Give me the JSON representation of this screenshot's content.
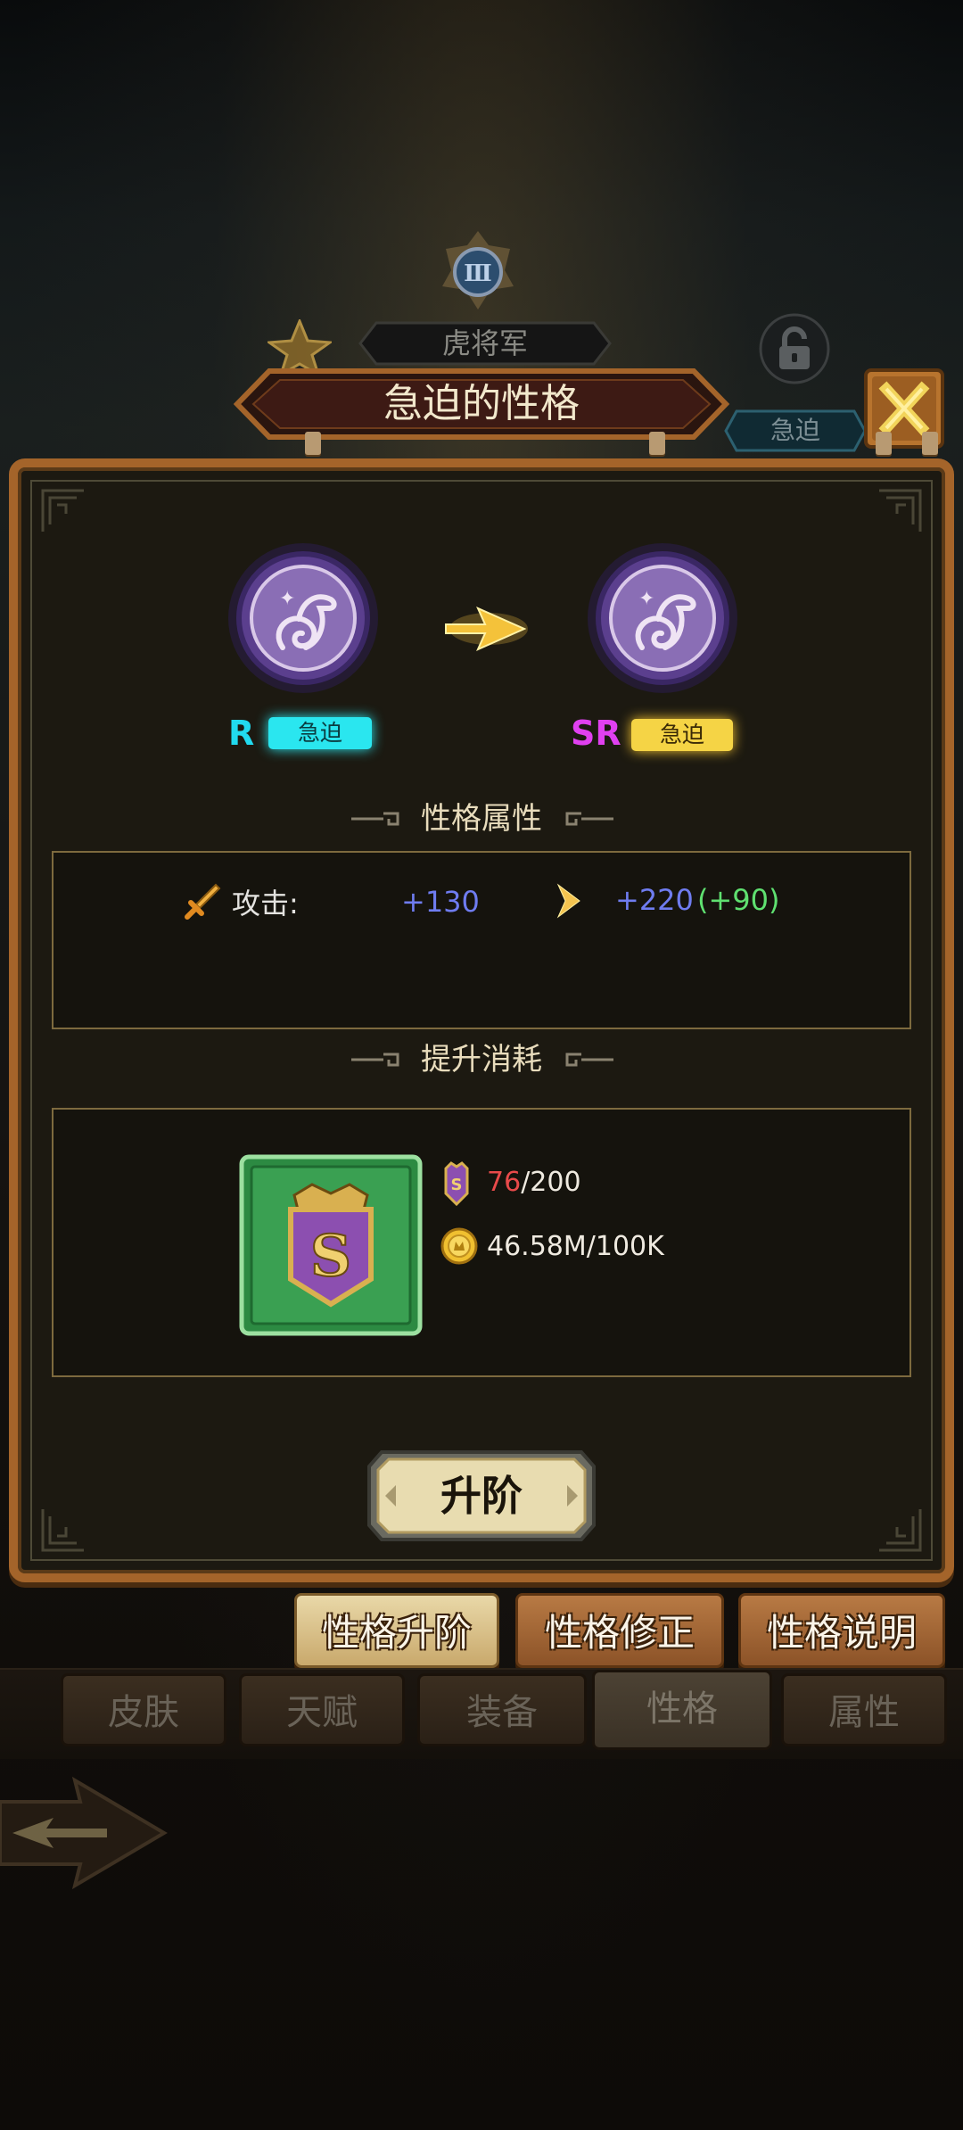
{
  "header": {
    "general_name": "虎将军",
    "personality_tag": "急迫",
    "dialog_title": "急迫的性格"
  },
  "upgrade_preview": {
    "current": {
      "rarity": "R",
      "rarity_color": "#21d9ee",
      "name": "急迫",
      "chip_color": "#2ae6ef"
    },
    "next": {
      "rarity": "SR",
      "rarity_color": "#e040f0",
      "name": "急迫",
      "chip_color": "#f5d445"
    }
  },
  "attributes": {
    "section_title": "性格属性",
    "rows": [
      {
        "icon": "sword-icon",
        "label": "攻击:",
        "current": "+130",
        "next": "+220",
        "delta": "(+90)"
      }
    ]
  },
  "cost": {
    "section_title": "提升消耗",
    "item_icon": "s-emblem-icon",
    "lines": [
      {
        "icon": "emblem-icon",
        "have": "76",
        "need": "/200",
        "have_color": "#e84a4a"
      },
      {
        "icon": "gold-coin-icon",
        "have": "",
        "need": "46.58M/100K",
        "have_color": "#efeae0"
      }
    ]
  },
  "upgrade_button": "升阶",
  "sub_tabs": [
    {
      "label": "性格升阶",
      "active": true
    },
    {
      "label": "性格修正",
      "active": false
    },
    {
      "label": "性格说明",
      "active": false
    }
  ],
  "bottom_tabs": [
    {
      "label": "皮肤",
      "active": false
    },
    {
      "label": "天赋",
      "active": false
    },
    {
      "label": "装备",
      "active": false
    },
    {
      "label": "性格",
      "active": true
    },
    {
      "label": "属性",
      "active": false
    }
  ],
  "colors": {
    "stat_value_blue": "#6f7cf0",
    "delta_green": "#5fe070",
    "panel_border": "#a4642a"
  }
}
